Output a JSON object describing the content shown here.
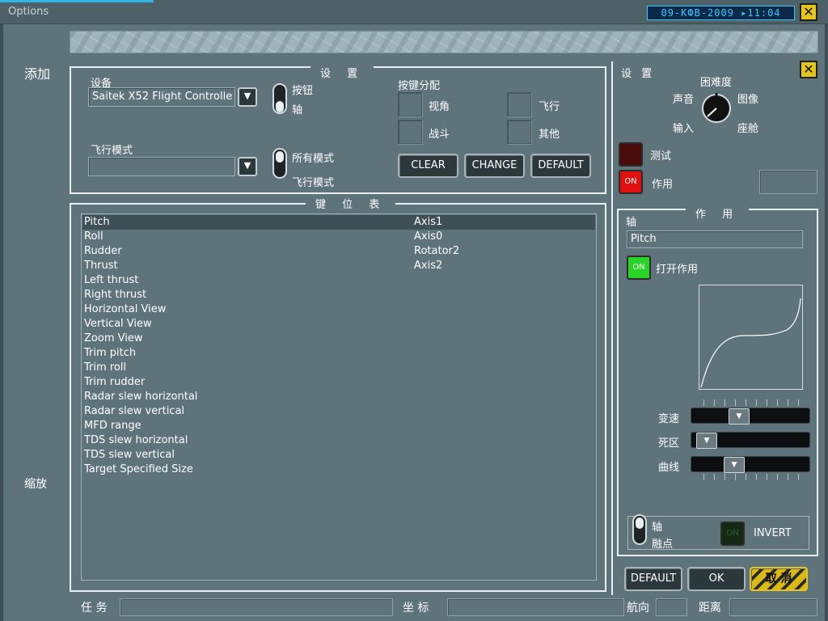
{
  "window": {
    "title": "Options",
    "clock": "09-КФВ-2009 ▸11:04"
  },
  "side": {
    "add": "添加",
    "zoom": "缩放"
  },
  "settings": {
    "legend": "设 置",
    "device_label": "设备",
    "device_value": "Saitek X52 Flight Controlle",
    "flight_mode_label": "飞行模式",
    "flight_mode_value": "",
    "toggle_top_a": "按钮",
    "toggle_top_b": "轴",
    "toggle_bot_a": "所有模式",
    "toggle_bot_b": "飞行模式",
    "assign_title": "按键分配",
    "assign": [
      "视角",
      "飞行",
      "战斗",
      "其他"
    ],
    "buttons": {
      "clear": "CLEAR",
      "change": "CHANGE",
      "default": "DEFAULT"
    }
  },
  "keymap": {
    "legend": "键 位 表",
    "rows": [
      {
        "name": "Pitch",
        "value": "Axis1",
        "selected": true
      },
      {
        "name": "Roll",
        "value": "Axis0"
      },
      {
        "name": "Rudder",
        "value": "Rotator2"
      },
      {
        "name": "Thrust",
        "value": "Axis2"
      },
      {
        "name": "Left thrust",
        "value": ""
      },
      {
        "name": "Right thrust",
        "value": ""
      },
      {
        "name": "Horizontal View",
        "value": ""
      },
      {
        "name": "Vertical View",
        "value": ""
      },
      {
        "name": "Zoom View",
        "value": ""
      },
      {
        "name": "Trim pitch",
        "value": ""
      },
      {
        "name": "Trim roll",
        "value": ""
      },
      {
        "name": "Trim rudder",
        "value": ""
      },
      {
        "name": "Radar slew horizontal",
        "value": ""
      },
      {
        "name": "Radar slew vertical",
        "value": ""
      },
      {
        "name": "MFD range",
        "value": ""
      },
      {
        "name": "TDS slew horizontal",
        "value": ""
      },
      {
        "name": "TDS slew vertical",
        "value": ""
      },
      {
        "name": "Target Specified Size",
        "value": ""
      }
    ]
  },
  "right": {
    "title": "设 置",
    "knob": {
      "top": "困难度",
      "sound": "声音",
      "image": "图像",
      "input": "输入",
      "cockpit": "座舱"
    },
    "test_label": "测试",
    "effect_label": "作用",
    "lamp_on": "ON",
    "effect_panel": {
      "legend": "作 用",
      "axis_label": "轴",
      "axis_value": "Pitch",
      "enable_label": "打开作用",
      "speed_label": "变速",
      "deadzone_label": "死区",
      "curve_label": "曲线",
      "levels": {
        "speed": 0.38,
        "deadzone": 0.05,
        "curve": 0.33
      },
      "toggle_a": "轴",
      "toggle_b": "融点",
      "invert_label": "INVERT"
    },
    "buttons": {
      "default": "DEFAULT",
      "ok": "OK",
      "cancel": "取 消"
    }
  },
  "status": {
    "task": "任 务",
    "coords": "坐 标",
    "heading": "航向",
    "distance": "距离"
  },
  "colors": {
    "background": "#5f737b",
    "accent_blue": "#2fb6e8",
    "lamp_red": "#e01010",
    "lamp_green": "#28d428",
    "yellow": "#e5c51b"
  }
}
